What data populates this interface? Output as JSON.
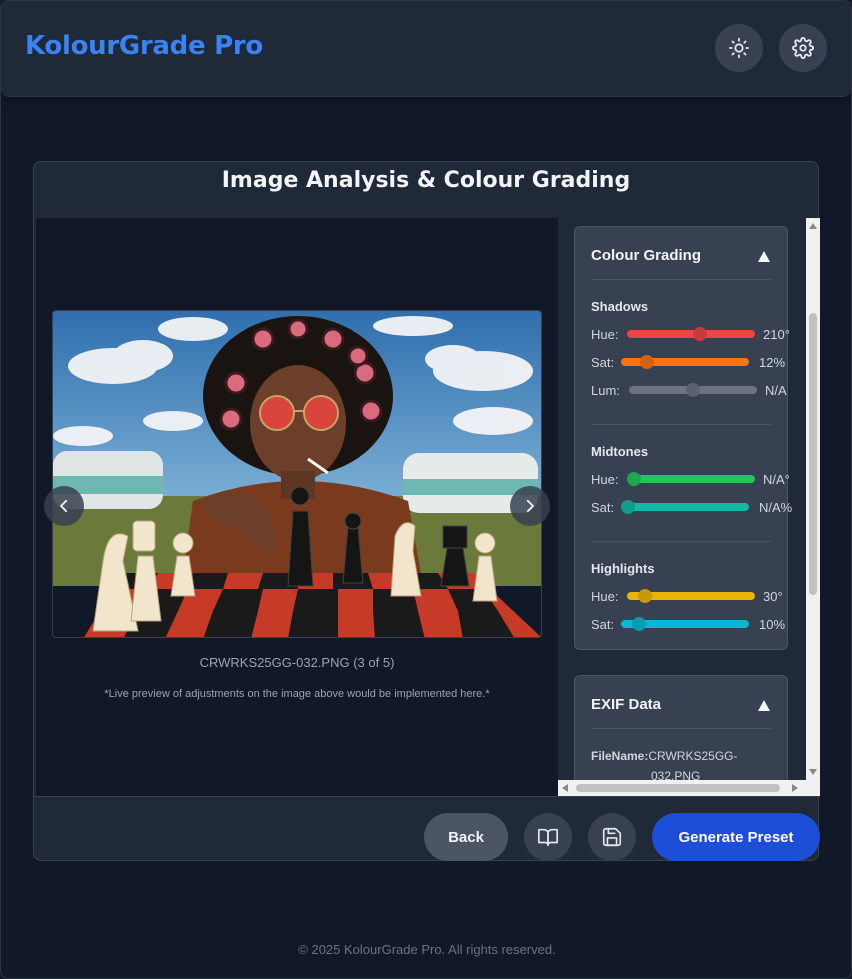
{
  "header": {
    "brand": "KolourGrade Pro",
    "theme_icon": "sun-icon",
    "settings_icon": "gear-icon"
  },
  "card": {
    "title": "Image Analysis & Colour Grading"
  },
  "preview": {
    "caption": "CRWRKS25GG-032.PNG (3 of 5)",
    "note": "*Live preview of adjustments on the image above would be implemented here.*",
    "prev_icon": "chevron-left-icon",
    "next_icon": "chevron-right-icon"
  },
  "grading": {
    "title": "Colour Grading",
    "shadows": {
      "title": "Shadows",
      "hue": {
        "label": "Hue:",
        "value": "210°",
        "level": 0.58,
        "color": "#ef4444"
      },
      "sat": {
        "label": "Sat:",
        "value": "12%",
        "level": 0.17,
        "color": "#f97316"
      },
      "lum": {
        "label": "Lum:",
        "value": "N/A",
        "level": 0.5,
        "color": "#6b7280"
      }
    },
    "midtones": {
      "title": "Midtones",
      "hue": {
        "label": "Hue:",
        "value": "N/A°",
        "level": 0.0,
        "color": "#22c55e"
      },
      "sat": {
        "label": "Sat:",
        "value": "N/A%",
        "level": 0.0,
        "color": "#14b8a6"
      }
    },
    "highlights": {
      "title": "Highlights",
      "hue": {
        "label": "Hue:",
        "value": "30°",
        "level": 0.1,
        "color": "#eab308"
      },
      "sat": {
        "label": "Sat:",
        "value": "10%",
        "level": 0.1,
        "color": "#06b6d4"
      }
    }
  },
  "exif": {
    "title": "EXIF Data",
    "filename_label": "FileName:",
    "filename_part1": "CRWRKS25GG-",
    "filename_part2": "032.PNG"
  },
  "actions": {
    "back": "Back",
    "guide_icon": "book-open-icon",
    "save_icon": "save-icon",
    "generate": "Generate Preset"
  },
  "footer": "© 2025 KolourGrade Pro. All rights reserved."
}
